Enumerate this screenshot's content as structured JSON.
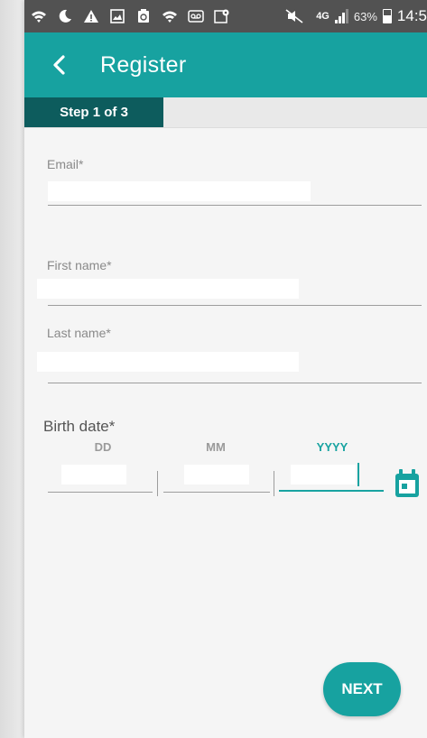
{
  "status_bar": {
    "icons": [
      "wifi-question-icon",
      "moon-icon",
      "warning-icon",
      "image-icon",
      "recycle-icon",
      "wifi-question-icon",
      "voicemail-icon",
      "location-icon",
      "mute-icon"
    ],
    "network_label": "4G",
    "battery_percent": "63%",
    "battery_level": 0.63,
    "time": "14:5"
  },
  "app_bar": {
    "title": "Register",
    "color": "#17a2a0"
  },
  "stepper": {
    "label": "Step 1 of 3"
  },
  "form": {
    "email": {
      "label": "Email*",
      "value": ""
    },
    "first_name": {
      "label": "First name*",
      "value": ""
    },
    "last_name": {
      "label": "Last name*",
      "value": ""
    },
    "birth_date": {
      "label": "Birth date*",
      "day_header": "DD",
      "month_header": "MM",
      "year_header": "YYYY",
      "day_value": "",
      "month_value": "",
      "year_value": ""
    }
  },
  "actions": {
    "next_label": "NEXT"
  },
  "colors": {
    "accent": "#17a2a0",
    "step_active": "#0d5c5d",
    "status_bar": "#525252"
  }
}
